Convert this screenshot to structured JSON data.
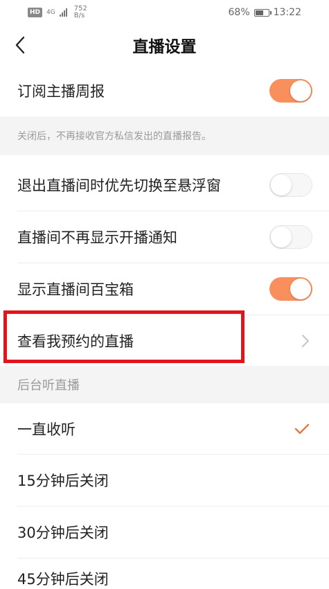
{
  "status_bar": {
    "hd": "HD",
    "network": "4G",
    "speed_value": "752",
    "speed_unit": "B/s",
    "battery": "68%",
    "time": "13:22"
  },
  "header": {
    "title": "直播设置"
  },
  "settings": [
    {
      "label": "订阅主播周报",
      "toggle": "on"
    },
    {
      "label": "退出直播间时优先切换至悬浮窗",
      "toggle": "off"
    },
    {
      "label": "直播间不再显示开播通知",
      "toggle": "off"
    },
    {
      "label": "显示直播间百宝箱",
      "toggle": "on"
    }
  ],
  "note": "关闭后，不再接收官方私信发出的直播报告。",
  "reservation_link": "查看我预约的直播",
  "section_title": "后台听直播",
  "listen_options": [
    {
      "label": "一直收听",
      "selected": true
    },
    {
      "label": "15分钟后关闭",
      "selected": false
    },
    {
      "label": "30分钟后关闭",
      "selected": false
    },
    {
      "label": "45分钟后关闭",
      "selected": false
    }
  ],
  "colors": {
    "accent": "#f88f5c",
    "highlight": "#e5141b",
    "check": "#e8773b"
  },
  "battery_level": 0.68
}
